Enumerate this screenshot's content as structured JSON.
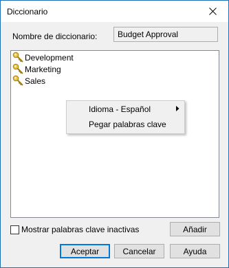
{
  "window": {
    "title": "Diccionario"
  },
  "dictionary": {
    "name_label": "Nombre de diccionario:",
    "name_value": "Budget Approval"
  },
  "tree": {
    "items": [
      {
        "label": "Development",
        "icon": "key-icon"
      },
      {
        "label": "Marketing",
        "icon": "key-icon"
      },
      {
        "label": "Sales",
        "icon": "key-icon"
      }
    ]
  },
  "context_menu": {
    "items": [
      {
        "label": "Idioma - Español",
        "has_submenu": true
      },
      {
        "label": "Pegar palabras clave",
        "has_submenu": false
      }
    ]
  },
  "options": {
    "show_inactive_label": "Mostrar palabras clave inactivas",
    "show_inactive_checked": false
  },
  "buttons": {
    "add": "Añadir",
    "accept": "Aceptar",
    "cancel": "Cancelar",
    "help": "Ayuda"
  },
  "colors": {
    "window_border": "#1a6fb5",
    "dialog_bg": "#f0f0f0",
    "default_button_border": "#0078d7",
    "key_icon": "#e8c440"
  }
}
